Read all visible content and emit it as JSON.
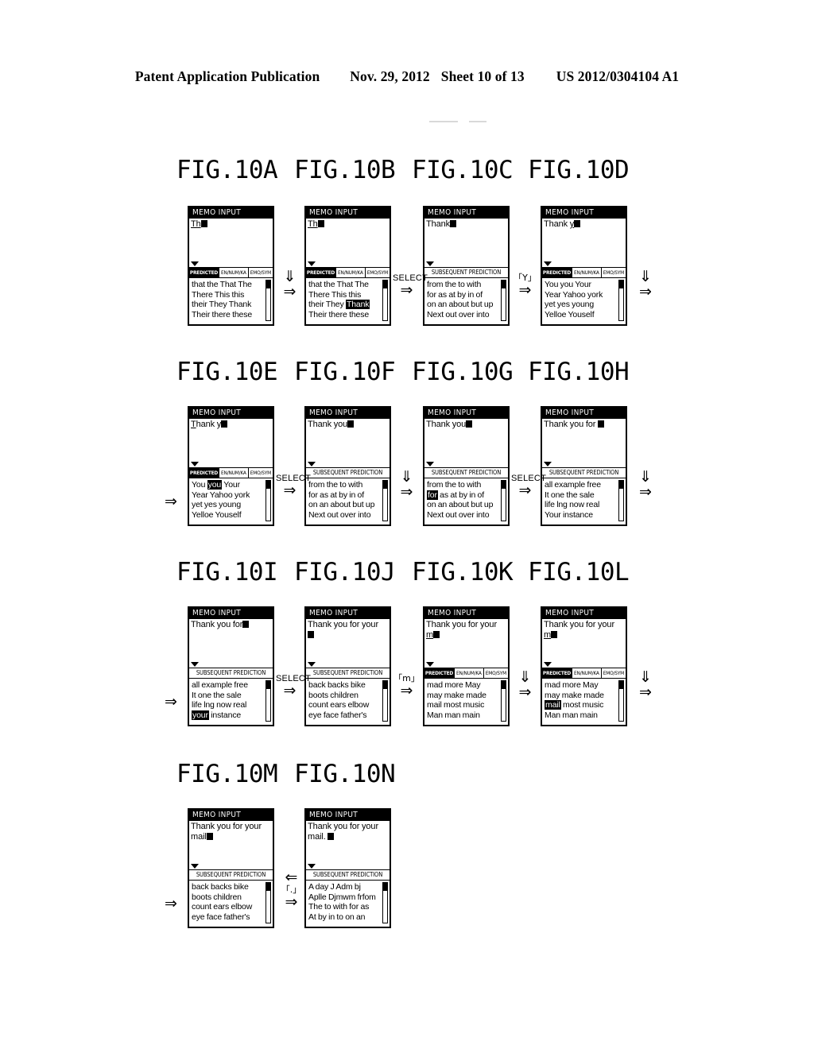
{
  "header": {
    "publication": "Patent Application Publication",
    "date": "Nov. 29, 2012",
    "sheet": "Sheet 10 of 13",
    "number": "US 2012/0304104 A1"
  },
  "glyphs": {
    "arrow_right": "⇒",
    "arrow_left": "⇐",
    "arrow_down": "⇓",
    "select": "SELECT"
  },
  "rows": [
    {
      "titles": [
        "FIG.10A",
        "FIG.10B",
        "FIG.10C",
        "FIG.10D"
      ],
      "panels": [
        {
          "title": "MEMO INPUT",
          "edit": [
            {
              "text": "Th",
              "underline": true
            }
          ],
          "caret": true,
          "mode": "tabs",
          "tabs": [
            "PREDICTED",
            "EN/NUM/KA",
            "EMO/SYM"
          ],
          "active_tab": 0,
          "candidates": [
            {
              "parts": [
                {
                  "t": "that the That The",
                  "hl": false
                }
              ]
            },
            {
              "parts": [
                {
                  "t": "There This this",
                  "hl": false
                }
              ]
            },
            {
              "parts": [
                {
                  "t": "their They Thank",
                  "hl": false
                }
              ]
            },
            {
              "parts": [
                {
                  "t": "Their there these",
                  "hl": false
                }
              ]
            }
          ]
        },
        {
          "title": "MEMO INPUT",
          "edit": [
            {
              "text": "Th",
              "underline": true
            }
          ],
          "caret": true,
          "mode": "tabs",
          "tabs": [
            "PREDICTED",
            "EN/NUM/KA",
            "EMO/SYM"
          ],
          "active_tab": 0,
          "candidates": [
            {
              "parts": [
                {
                  "t": "that the That The",
                  "hl": false
                }
              ]
            },
            {
              "parts": [
                {
                  "t": "There This this",
                  "hl": false
                }
              ]
            },
            {
              "parts": [
                {
                  "t": "their They ",
                  "hl": false
                },
                {
                  "t": "Thank",
                  "hl": true
                }
              ]
            },
            {
              "parts": [
                {
                  "t": "Their there these",
                  "hl": false
                }
              ]
            }
          ]
        },
        {
          "title": "MEMO INPUT",
          "edit": [
            {
              "text": "Thank",
              "underline": false
            }
          ],
          "caret": true,
          "mode": "single",
          "header": "SUBSEQUENT PREDICTION",
          "candidates": [
            {
              "parts": [
                {
                  "t": "from the to with",
                  "hl": false
                }
              ]
            },
            {
              "parts": [
                {
                  "t": "for as at by in of",
                  "hl": false
                }
              ]
            },
            {
              "parts": [
                {
                  "t": "on an about but up",
                  "hl": false
                }
              ]
            },
            {
              "parts": [
                {
                  "t": "Next out over into",
                  "hl": false
                }
              ]
            }
          ]
        },
        {
          "title": "MEMO INPUT",
          "edit": [
            {
              "text": "Thank ",
              "underline": false
            },
            {
              "text": "y",
              "underline": true
            }
          ],
          "caret": true,
          "mode": "tabs",
          "tabs": [
            "PREDICTED",
            "EN/NUM/KA",
            "EMO/SYM"
          ],
          "active_tab": 0,
          "candidates": [
            {
              "parts": [
                {
                  "t": "You you Your",
                  "hl": false
                }
              ]
            },
            {
              "parts": [
                {
                  "t": "Year Yahoo york",
                  "hl": false
                }
              ]
            },
            {
              "parts": [
                {
                  "t": "yet yes young",
                  "hl": false
                }
              ]
            },
            {
              "parts": [
                {
                  "t": "Yelloe Youself",
                  "hl": false
                }
              ]
            }
          ]
        }
      ],
      "connectors": [
        {
          "label": "",
          "after": 0
        },
        {
          "label": "SELECT",
          "after": 1
        },
        {
          "label": "「Y」",
          "after": 2
        },
        {
          "label": "",
          "after": 3
        }
      ]
    },
    {
      "titles": [
        "FIG.10E",
        "FIG.10F",
        "FIG.10G",
        "FIG.10H"
      ],
      "panels": [
        {
          "title": "MEMO INPUT",
          "edit": [
            {
              "text": "T",
              "underline": true
            },
            {
              "text": "hank y",
              "underline": false
            }
          ],
          "caret": true,
          "mode": "tabs",
          "tabs": [
            "PREDICTED",
            "EN/NUM/KA",
            "EMO/SYM"
          ],
          "active_tab": 0,
          "candidates": [
            {
              "parts": [
                {
                  "t": "You ",
                  "hl": false
                },
                {
                  "t": "you",
                  "hl": true
                },
                {
                  "t": " Your",
                  "hl": false
                }
              ]
            },
            {
              "parts": [
                {
                  "t": "Year Yahoo york",
                  "hl": false
                }
              ]
            },
            {
              "parts": [
                {
                  "t": "yet yes young",
                  "hl": false
                }
              ]
            },
            {
              "parts": [
                {
                  "t": "Yelloe Youself",
                  "hl": false
                }
              ]
            }
          ]
        },
        {
          "title": "MEMO INPUT",
          "edit": [
            {
              "text": "Thank you",
              "underline": false
            }
          ],
          "caret": true,
          "mode": "single",
          "header": "SUBSEQUENT PREDICTION",
          "candidates": [
            {
              "parts": [
                {
                  "t": "from the to with",
                  "hl": false
                }
              ]
            },
            {
              "parts": [
                {
                  "t": "for as at by in of",
                  "hl": false
                }
              ]
            },
            {
              "parts": [
                {
                  "t": "on an about but up",
                  "hl": false
                }
              ]
            },
            {
              "parts": [
                {
                  "t": "Next out over into",
                  "hl": false
                }
              ]
            }
          ]
        },
        {
          "title": "MEMO INPUT",
          "edit": [
            {
              "text": "Thank you",
              "underline": false
            }
          ],
          "caret": true,
          "mode": "single",
          "header": "SUBSEQUENT PREDICTION",
          "candidates": [
            {
              "parts": [
                {
                  "t": "from the to with",
                  "hl": false
                }
              ]
            },
            {
              "parts": [
                {
                  "t": "for",
                  "hl": true
                },
                {
                  "t": " as at by in of",
                  "hl": false
                }
              ]
            },
            {
              "parts": [
                {
                  "t": "on an about but up",
                  "hl": false
                }
              ]
            },
            {
              "parts": [
                {
                  "t": "Next out over into",
                  "hl": false
                }
              ]
            }
          ]
        },
        {
          "title": "MEMO INPUT",
          "edit": [
            {
              "text": "Thank you for ",
              "underline": false
            }
          ],
          "caret": true,
          "mode": "single",
          "header": "SUBSEQUENT PREDICTION",
          "candidates": [
            {
              "parts": [
                {
                  "t": "all example free",
                  "hl": false
                }
              ]
            },
            {
              "parts": [
                {
                  "t": "It one the sale",
                  "hl": false
                }
              ]
            },
            {
              "parts": [
                {
                  "t": "life lng now real",
                  "hl": false
                }
              ]
            },
            {
              "parts": [
                {
                  "t": "Your instance",
                  "hl": false
                }
              ]
            }
          ]
        }
      ],
      "connectors": [
        {
          "label": "SELECT",
          "after": 0
        },
        {
          "label": "",
          "after": 1
        },
        {
          "label": "SELECT",
          "after": 2
        },
        {
          "label": "",
          "after": 3
        }
      ]
    },
    {
      "titles": [
        "FIG.10I",
        "FIG.10J",
        "FIG.10K",
        "FIG.10L"
      ],
      "panels": [
        {
          "title": "MEMO INPUT",
          "edit": [
            {
              "text": "Thank you for",
              "underline": false
            }
          ],
          "caret": true,
          "mode": "single",
          "header": "SUBSEQUENT PREDICTION",
          "candidates": [
            {
              "parts": [
                {
                  "t": "all example free",
                  "hl": false
                }
              ]
            },
            {
              "parts": [
                {
                  "t": "It one the sale",
                  "hl": false
                }
              ]
            },
            {
              "parts": [
                {
                  "t": "life lng now real",
                  "hl": false
                }
              ]
            },
            {
              "parts": [
                {
                  "t": "your",
                  "hl": true
                },
                {
                  "t": " instance",
                  "hl": false
                }
              ]
            }
          ]
        },
        {
          "title": "MEMO INPUT",
          "edit": [
            {
              "text": "Thank you for your",
              "underline": false
            }
          ],
          "caret": true,
          "caret_newline": true,
          "mode": "single",
          "header": "SUBSEQUENT PREDICTION",
          "candidates": [
            {
              "parts": [
                {
                  "t": "back backs bike",
                  "hl": false
                }
              ]
            },
            {
              "parts": [
                {
                  "t": "boots children",
                  "hl": false
                }
              ]
            },
            {
              "parts": [
                {
                  "t": "count ears elbow",
                  "hl": false
                }
              ]
            },
            {
              "parts": [
                {
                  "t": "eye face father's",
                  "hl": false
                }
              ]
            }
          ]
        },
        {
          "title": "MEMO INPUT",
          "edit": [
            {
              "text": "Thank you for your",
              "underline": false
            }
          ],
          "edit2": [
            {
              "text": "m",
              "underline": true
            }
          ],
          "caret": true,
          "mode": "tabs",
          "tabs": [
            "PREDICTED",
            "EN/NUM/KA",
            "EMO/SYM"
          ],
          "active_tab": 0,
          "candidates": [
            {
              "parts": [
                {
                  "t": "mad more May",
                  "hl": false
                }
              ]
            },
            {
              "parts": [
                {
                  "t": "may make made",
                  "hl": false
                }
              ]
            },
            {
              "parts": [
                {
                  "t": "mail most music",
                  "hl": false
                }
              ]
            },
            {
              "parts": [
                {
                  "t": "Man man main",
                  "hl": false
                }
              ]
            }
          ]
        },
        {
          "title": "MEMO INPUT",
          "edit": [
            {
              "text": "Thank you for your",
              "underline": false
            }
          ],
          "edit2": [
            {
              "text": "m",
              "underline": true
            }
          ],
          "caret": true,
          "mode": "tabs",
          "tabs": [
            "PREDICTED",
            "EN/NUM/KA",
            "EMO/SYM"
          ],
          "active_tab": 0,
          "candidates": [
            {
              "parts": [
                {
                  "t": "mad more May",
                  "hl": false
                }
              ]
            },
            {
              "parts": [
                {
                  "t": "may make made",
                  "hl": false
                }
              ]
            },
            {
              "parts": [
                {
                  "t": "mail",
                  "hl": true
                },
                {
                  "t": " most music",
                  "hl": false
                }
              ]
            },
            {
              "parts": [
                {
                  "t": "Man man main",
                  "hl": false
                }
              ]
            }
          ]
        }
      ],
      "connectors": [
        {
          "label": "SELECT",
          "after": 0
        },
        {
          "label": "「m」",
          "after": 1
        },
        {
          "label": "",
          "after": 2
        },
        {
          "label": "SELECT",
          "after": 3
        }
      ]
    },
    {
      "titles": [
        "FIG.10M",
        "FIG.10N"
      ],
      "panels": [
        {
          "title": "MEMO INPUT",
          "edit": [
            {
              "text": "Thank you for your",
              "underline": false
            }
          ],
          "edit2": [
            {
              "text": "mail",
              "underline": false
            }
          ],
          "caret": true,
          "mode": "single",
          "header": "SUBSEQUENT PREDICTION",
          "candidates": [
            {
              "parts": [
                {
                  "t": "back backs bike",
                  "hl": false
                }
              ]
            },
            {
              "parts": [
                {
                  "t": "boots children",
                  "hl": false
                }
              ]
            },
            {
              "parts": [
                {
                  "t": "count ears elbow",
                  "hl": false
                }
              ]
            },
            {
              "parts": [
                {
                  "t": "eye face father's",
                  "hl": false
                }
              ]
            }
          ]
        },
        {
          "title": "MEMO INPUT",
          "edit": [
            {
              "text": "Thank you for your",
              "underline": false
            }
          ],
          "edit2": [
            {
              "text": "mail. ",
              "underline": false
            }
          ],
          "caret": true,
          "mode": "single",
          "header": "SUBSEQUENT PREDICTION",
          "candidates": [
            {
              "parts": [
                {
                  "t": "A day J Adm bj",
                  "hl": false
                }
              ]
            },
            {
              "parts": [
                {
                  "t": "Aplle Djmwm frfom",
                  "hl": false
                }
              ]
            },
            {
              "parts": [
                {
                  "t": "The to with for as",
                  "hl": false
                }
              ]
            },
            {
              "parts": [
                {
                  "t": "At by in to on an",
                  "hl": false
                }
              ]
            }
          ]
        }
      ],
      "connectors": [
        {
          "label": "「.」",
          "after": 0
        }
      ]
    }
  ]
}
